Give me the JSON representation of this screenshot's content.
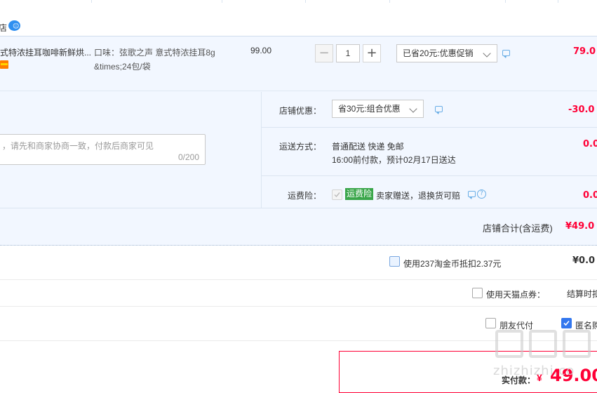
{
  "colors": {
    "accent": "#ff0036",
    "blue": "#3388ff",
    "table_bg": "#f2f7ff",
    "green": "#3aa64a"
  },
  "shop": {
    "icon": "chat-bubble-icon",
    "name_fragment": "店"
  },
  "item": {
    "title": "式特浓挂耳咖啡新鲜烘...",
    "spec_line1": "口味：弦歌之声 意式特浓挂耳8g",
    "spec_line2": "&times;24包/袋",
    "unit_price": "99.00",
    "qty": "1",
    "qty_minus": "−",
    "qty_plus": "+",
    "promo_select": "已省20元:优惠促销",
    "subtotal": "79.0"
  },
  "message": {
    "placeholder": "，请先和商家协商一致，付款后商家可见",
    "counter": "0/200"
  },
  "shop_discount": {
    "label": "店铺优惠：",
    "select": "省30元:组合优惠",
    "value": "-30.0"
  },
  "shipping": {
    "label": "运送方式：",
    "line1": "普通配送 快递 免邮",
    "line2": "16:00前付款，预计02月17日送达",
    "value": "0.0"
  },
  "insurance": {
    "label": "运费险：",
    "badge": "运费险",
    "desc": "卖家赠送，退换货可赔",
    "value": "0.0"
  },
  "shop_total": {
    "label": "店铺合计(含运费)",
    "value": "¥49.0"
  },
  "coins": {
    "label": "使用237淘金币抵扣2.37元",
    "value": "¥0.0"
  },
  "points": {
    "label": "使用天猫点券：",
    "hint": "结算时扣"
  },
  "friend_pay": {
    "label": "朋友代付"
  },
  "anonymous": {
    "label": "匿名购"
  },
  "pay": {
    "label": "实付款：",
    "currency": "¥",
    "amount": "49.00"
  },
  "watermark": {
    "logo": "值值值",
    "text": "zhizhizhi.co"
  }
}
